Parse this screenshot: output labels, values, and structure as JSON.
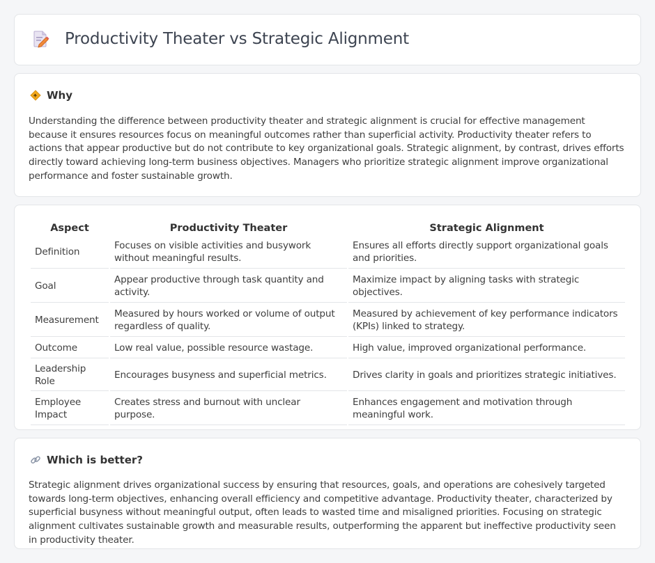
{
  "header": {
    "title": "Productivity Theater vs Strategic Alignment",
    "icon": "document-edit-icon"
  },
  "why": {
    "icon": "diamond-sign-icon",
    "heading": "Why",
    "text": "Understanding the difference between productivity theater and strategic alignment is crucial for effective management because it ensures resources focus on meaningful outcomes rather than superficial activity. Productivity theater refers to actions that appear productive but do not contribute to key organizational goals. Strategic alignment, by contrast, drives efforts directly toward achieving long-term business objectives. Managers who prioritize strategic alignment improve organizational performance and foster sustainable growth."
  },
  "comparison": {
    "headers": [
      "Aspect",
      "Productivity Theater",
      "Strategic Alignment"
    ],
    "rows": [
      [
        "Definition",
        "Focuses on visible activities and busywork without meaningful results.",
        "Ensures all efforts directly support organizational goals and priorities."
      ],
      [
        "Goal",
        "Appear productive through task quantity and activity.",
        "Maximize impact by aligning tasks with strategic objectives."
      ],
      [
        "Measurement",
        "Measured by hours worked or volume of output regardless of quality.",
        "Measured by achievement of key performance indicators (KPIs) linked to strategy."
      ],
      [
        "Outcome",
        "Low real value, possible resource wastage.",
        "High value, improved organizational performance."
      ],
      [
        "Leadership Role",
        "Encourages busyness and superficial metrics.",
        "Drives clarity in goals and prioritizes strategic initiatives."
      ],
      [
        "Employee Impact",
        "Creates stress and burnout with unclear purpose.",
        "Enhances engagement and motivation through meaningful work."
      ]
    ]
  },
  "better": {
    "icon": "link-icon",
    "heading": "Which is better?",
    "text": "Strategic alignment drives organizational success by ensuring that resources, goals, and operations are cohesively targeted towards long-term objectives, enhancing overall efficiency and competitive advantage. Productivity theater, characterized by superficial busyness without meaningful output, often leads to wasted time and misaligned priorities. Focusing on strategic alignment cultivates sustainable growth and measurable results, outperforming the apparent but ineffective productivity seen in productivity theater."
  }
}
